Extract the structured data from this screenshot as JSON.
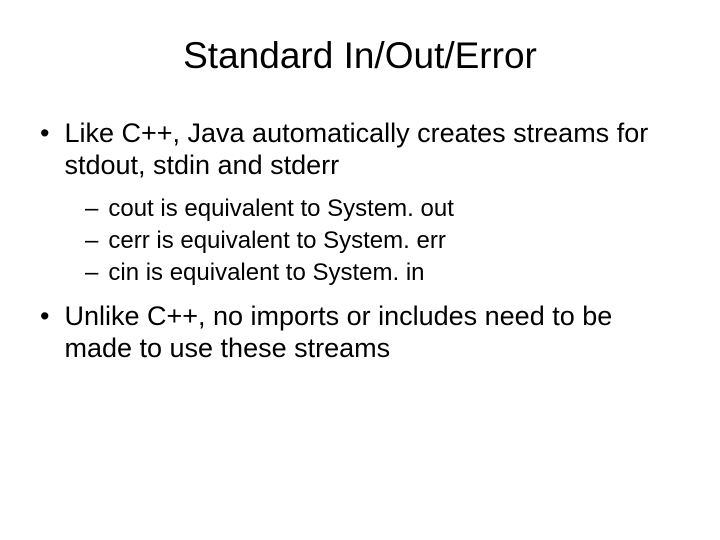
{
  "title": "Standard In/Out/Error",
  "bullets": [
    {
      "text": "Like C++, Java automatically creates streams for stdout, stdin and stderr",
      "sub": [
        "cout is equivalent to System. out",
        "cerr is equivalent to System. err",
        "cin is equivalent to System. in"
      ]
    },
    {
      "text": "Unlike C++, no imports or includes need to be made to use these streams",
      "sub": []
    }
  ]
}
